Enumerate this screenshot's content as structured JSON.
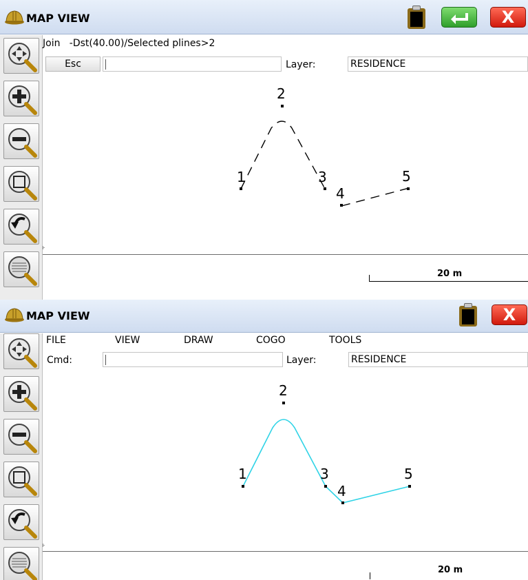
{
  "top_panel": {
    "title": "MAP VIEW",
    "command_text": "Join   -Dst(40.00)/Selected plines>2",
    "esc_label": "Esc",
    "layer_label": "Layer:",
    "layer_value": "RESIDENCE",
    "scale_label": "20 m",
    "points": [
      {
        "label": "1"
      },
      {
        "label": "2"
      },
      {
        "label": "3"
      },
      {
        "label": "4"
      },
      {
        "label": "5"
      }
    ],
    "line_color": "#000000",
    "line_style": "dashed"
  },
  "bottom_panel": {
    "title": "MAP VIEW",
    "menu": [
      "FILE",
      "VIEW",
      "DRAW",
      "COGO",
      "TOOLS"
    ],
    "cmd_label": "Cmd:",
    "layer_label": "Layer:",
    "layer_value": "RESIDENCE",
    "scale_label": "20 m",
    "points": [
      {
        "label": "1"
      },
      {
        "label": "2"
      },
      {
        "label": "3"
      },
      {
        "label": "4"
      },
      {
        "label": "5"
      }
    ],
    "line_color": "#2fd3e6",
    "line_style": "solid"
  },
  "toolbar_icons": [
    "pan-icon",
    "zoom-in-icon",
    "zoom-out-icon",
    "zoom-window-icon",
    "zoom-previous-icon",
    "zoom-extents-icon"
  ],
  "colors": {
    "titlebar": "#dce7f5",
    "ok_button": "#3fb63b",
    "close_button": "#e3281a",
    "polyline_selected": "#2fd3e6"
  }
}
